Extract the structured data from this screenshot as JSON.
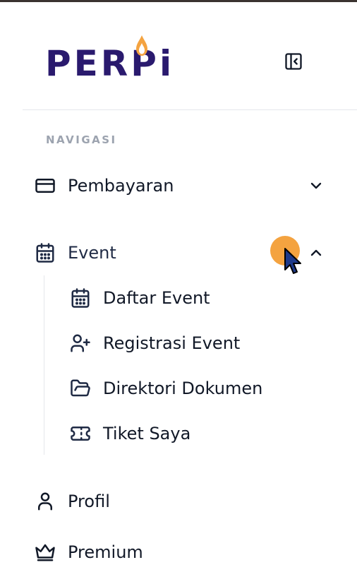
{
  "brand": {
    "logo_text": "PERPi",
    "flame_color": "#f4a340",
    "logo_color": "#2a1a6e"
  },
  "header": {
    "collapse_icon": "sidebar-collapse-icon"
  },
  "nav": {
    "section_label": "NAVIGASI",
    "items": [
      {
        "label": "Pembayaran",
        "icon": "credit-card-icon",
        "expanded": false
      },
      {
        "label": "Event",
        "icon": "calendar-icon",
        "expanded": true,
        "children": [
          {
            "label": "Daftar Event",
            "icon": "calendar-grid-icon"
          },
          {
            "label": "Registrasi Event",
            "icon": "user-plus-icon"
          },
          {
            "label": "Direktori Dokumen",
            "icon": "folder-open-icon"
          },
          {
            "label": "Tiket Saya",
            "icon": "ticket-icon"
          }
        ]
      },
      {
        "label": "Profil",
        "icon": "user-icon"
      },
      {
        "label": "Premium",
        "icon": "crown-icon"
      }
    ]
  },
  "colors": {
    "text": "#111827",
    "muted": "#9ca3af",
    "icon": "#1f2a44",
    "cursor_highlight": "#f4a340"
  }
}
